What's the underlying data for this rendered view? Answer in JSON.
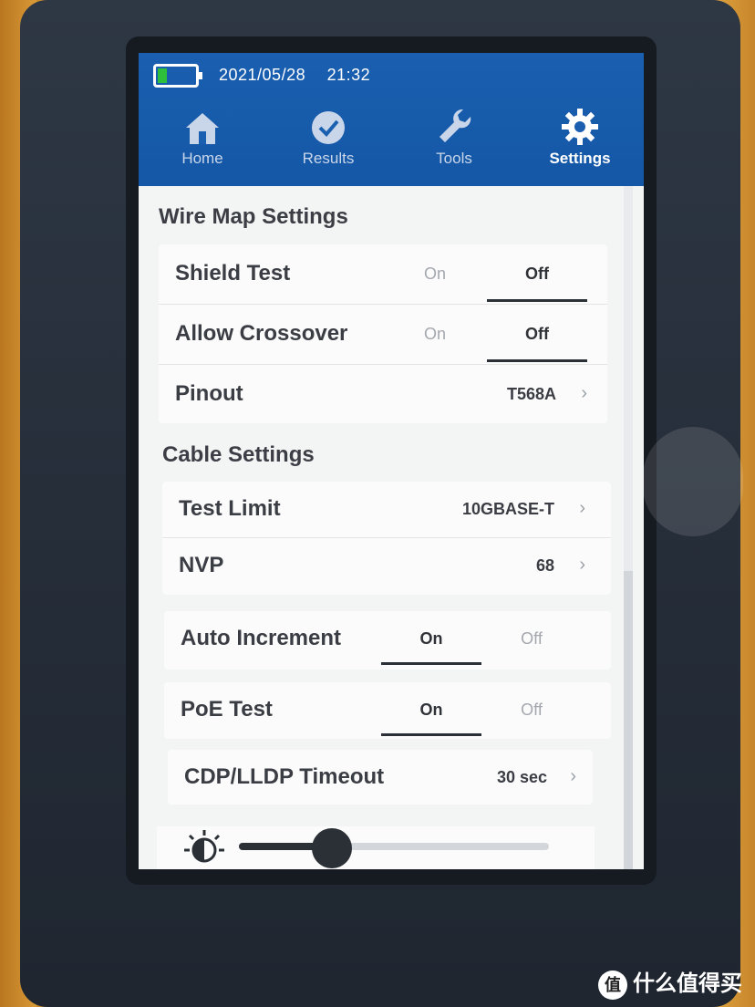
{
  "status": {
    "date": "2021/05/28",
    "time": "21:32"
  },
  "tabs": [
    {
      "label": "Home",
      "icon": "home-icon"
    },
    {
      "label": "Results",
      "icon": "check-circle-icon"
    },
    {
      "label": "Tools",
      "icon": "wrench-icon"
    },
    {
      "label": "Settings",
      "icon": "gear-icon",
      "active": true
    }
  ],
  "wire_map": {
    "title": "Wire Map Settings",
    "shield_test": {
      "label": "Shield Test",
      "on": "On",
      "off": "Off",
      "selected": "Off"
    },
    "allow_crossover": {
      "label": "Allow Crossover",
      "on": "On",
      "off": "Off",
      "selected": "Off"
    },
    "pinout": {
      "label": "Pinout",
      "value": "T568A",
      "chevron": "›"
    }
  },
  "cable": {
    "title": "Cable Settings",
    "test_limit": {
      "label": "Test Limit",
      "value": "10GBASE-T",
      "chevron": "›"
    },
    "nvp": {
      "label": "NVP",
      "value": "68",
      "chevron": "›"
    },
    "auto_increment": {
      "label": "Auto Increment",
      "on": "On",
      "off": "Off",
      "selected": "On"
    },
    "poe_test": {
      "label": "PoE Test",
      "on": "On",
      "off": "Off",
      "selected": "On"
    },
    "cdp_lldp": {
      "label": "CDP/LLDP Timeout",
      "value": "30 sec",
      "chevron": "›"
    }
  },
  "brightness": {
    "level": 0.3,
    "icon": "brightness-icon"
  },
  "watermark": {
    "badge": "值",
    "text": "什么值得买"
  },
  "colors": {
    "header": "#1a5fb0",
    "battery": "#2ec03a",
    "accent": "#2b3036"
  }
}
